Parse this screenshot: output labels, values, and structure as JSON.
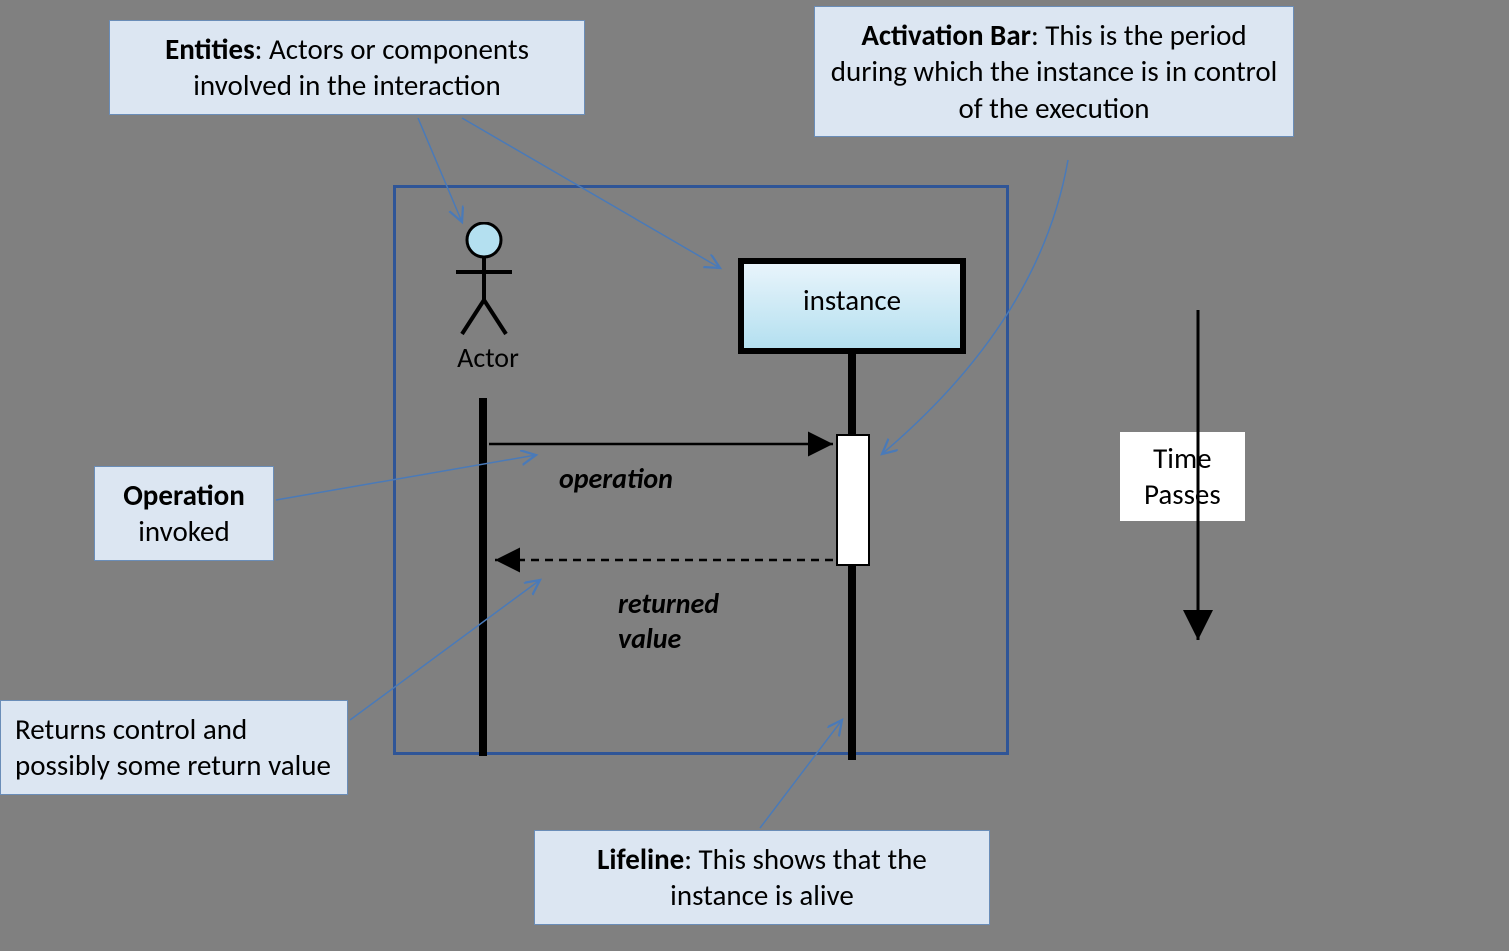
{
  "callouts": {
    "entities": {
      "title": "Entities",
      "body": ":  Actors or components involved in the interaction"
    },
    "activation": {
      "title": "Activation Bar",
      "body": ": This is the period during which the instance is in control of the execution"
    },
    "operation": {
      "title": "Operation",
      "body": "invoked"
    },
    "returns": {
      "body": "Returns control and possibly some return value"
    },
    "lifeline": {
      "title": "Lifeline",
      "body": ": This shows that the instance is alive"
    }
  },
  "diagram": {
    "actor_label": "Actor",
    "instance_label": "instance",
    "operation_msg": "operation",
    "return_msg_line1": "returned",
    "return_msg_line2": "value"
  },
  "time": {
    "line1": "Time",
    "line2": "Passes"
  }
}
